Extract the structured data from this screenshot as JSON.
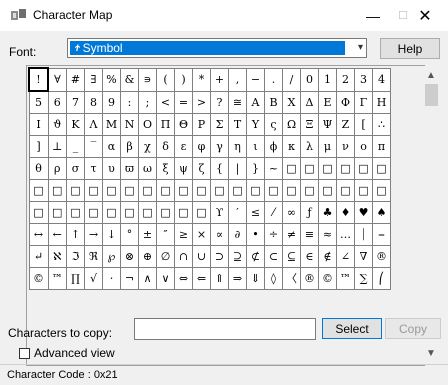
{
  "window": {
    "title": "Character Map",
    "minimize": "—",
    "maximize": "☐",
    "close": "✕"
  },
  "font": {
    "label": "Font:",
    "selected": "Symbol",
    "icon_text": "Ϯ"
  },
  "help_label": "Help",
  "grid": {
    "columns": 20,
    "selected_index": 0,
    "chars": [
      "!",
      "∀",
      "#",
      "∃",
      "%",
      "&",
      "∍",
      "(",
      ")",
      "*",
      "+",
      ",",
      "−",
      ".",
      "/",
      "0",
      "1",
      "2",
      "3",
      "4",
      "5",
      "6",
      "7",
      "8",
      "9",
      ":",
      ";",
      "<",
      "=",
      ">",
      "?",
      "≅",
      "Α",
      "Β",
      "Χ",
      "Δ",
      "Ε",
      "Φ",
      "Γ",
      "Η",
      "Ι",
      "ϑ",
      "Κ",
      "Λ",
      "Μ",
      "Ν",
      "Ο",
      "Π",
      "Θ",
      "Ρ",
      "Σ",
      "Τ",
      "Υ",
      "ς",
      "Ω",
      "Ξ",
      "Ψ",
      "Ζ",
      "[",
      "∴",
      "]",
      "⊥",
      "_",
      "‾",
      "α",
      "β",
      "χ",
      "δ",
      "ε",
      "φ",
      "γ",
      "η",
      "ι",
      "ϕ",
      "κ",
      "λ",
      "μ",
      "ν",
      "ο",
      "π",
      "θ",
      "ρ",
      "σ",
      "τ",
      "υ",
      "ϖ",
      "ω",
      "ξ",
      "ψ",
      "ζ",
      "{",
      "|",
      "}",
      "~",
      "□",
      "□",
      "□",
      "□",
      "□",
      "□",
      "□",
      "□",
      "□",
      "□",
      "□",
      "□",
      "□",
      "□",
      "□",
      "□",
      "□",
      "□",
      "□",
      "□",
      "□",
      "□",
      "□",
      "□",
      "□",
      "□",
      "□",
      "□",
      "□",
      "□",
      "□",
      "□",
      "□",
      "□",
      "□",
      "□",
      "ϒ",
      "′",
      "≤",
      "⁄",
      "∞",
      "ƒ",
      "♣",
      "♦",
      "♥",
      "♠",
      "↔",
      "←",
      "↑",
      "→",
      "↓",
      "°",
      "±",
      "″",
      "≥",
      "×",
      "∝",
      "∂",
      "•",
      "÷",
      "≠",
      "≡",
      "≈",
      "…",
      "⏐",
      "⎯",
      "↵",
      "ℵ",
      "ℑ",
      "ℜ",
      "℘",
      "⊗",
      "⊕",
      "∅",
      "∩",
      "∪",
      "⊃",
      "⊇",
      "⊄",
      "⊂",
      "⊆",
      "∈",
      "∉",
      "∠",
      "∇",
      "®",
      "©",
      "™",
      "∏",
      "√",
      "⋅",
      "¬",
      "∧",
      "∨",
      "⇔",
      "⇐",
      "⇑",
      "⇒",
      "⇓",
      "◊",
      "〈",
      "®",
      "©",
      "™",
      "∑",
      "⎛",
      "⎜",
      "⎝"
    ]
  },
  "copy": {
    "label": "Characters to copy:",
    "value": "",
    "select_label": "Select",
    "copy_label": "Copy"
  },
  "advanced_view": {
    "label": "Advanced view",
    "checked": false
  },
  "status": "Character Code : 0x21"
}
